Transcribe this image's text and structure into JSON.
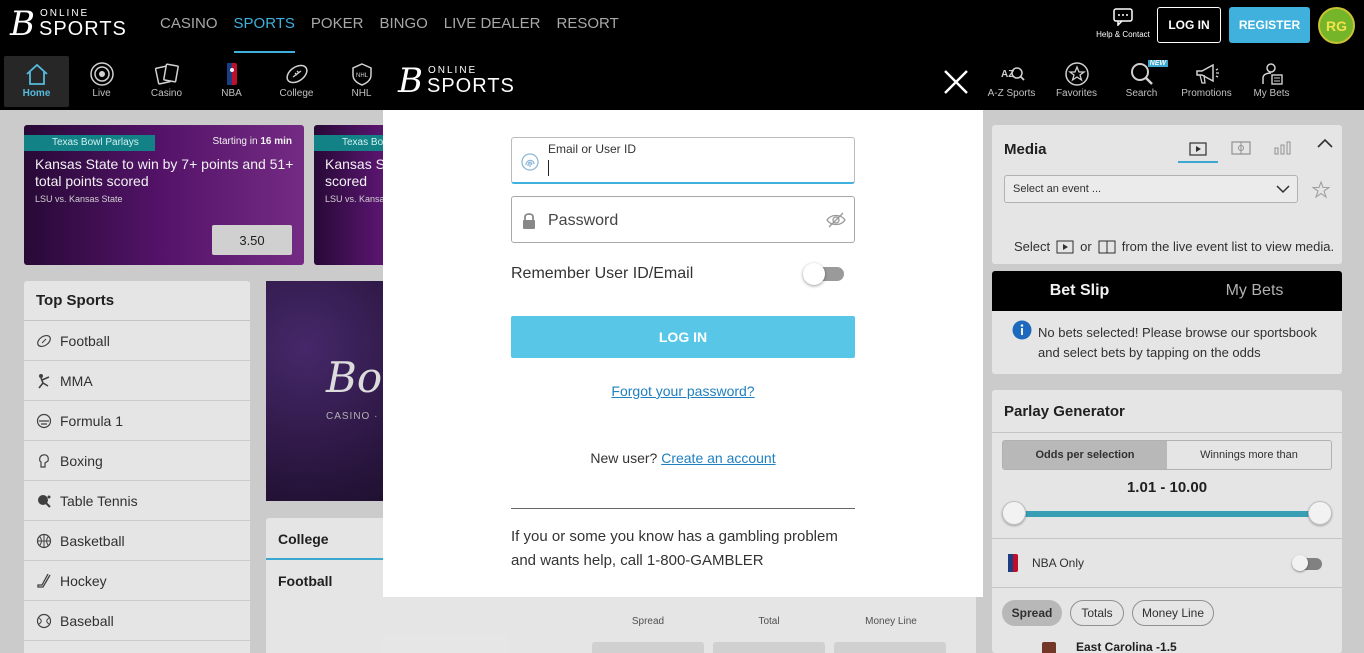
{
  "brand": {
    "mark": "B",
    "online": "ONLINE",
    "sports": "SPORTS"
  },
  "topnav": [
    "CASINO",
    "SPORTS",
    "POKER",
    "BINGO",
    "LIVE DEALER",
    "RESORT"
  ],
  "header": {
    "help": "Help & Contact",
    "login": "LOG IN",
    "register": "REGISTER",
    "rg": "RG"
  },
  "subnav": {
    "left": [
      {
        "label": "Home",
        "icon": "home-icon"
      },
      {
        "label": "Live",
        "icon": "live-icon"
      },
      {
        "label": "Casino",
        "icon": "casino-cards-icon"
      },
      {
        "label": "NBA",
        "icon": "nba-icon"
      },
      {
        "label": "College",
        "icon": "football-icon"
      },
      {
        "label": "NHL",
        "icon": "nhl-icon"
      }
    ],
    "right": [
      {
        "label": "A-Z Sports",
        "icon": "az-sports-icon"
      },
      {
        "label": "Favorites",
        "icon": "star-icon"
      },
      {
        "label": "Search",
        "icon": "search-icon",
        "badge": "NEW"
      },
      {
        "label": "Promotions",
        "icon": "megaphone-icon"
      },
      {
        "label": "My Bets",
        "icon": "my-bets-icon"
      }
    ]
  },
  "promos": [
    {
      "tag": "Texas Bowl Parlays",
      "start_prefix": "Starting in ",
      "start_time": "16 min",
      "title": "Kansas State to win by 7+ points and 51+ total points scored",
      "teams": "LSU vs. Kansas State",
      "odds": "3.50"
    },
    {
      "tag": "Texas Bowl",
      "title": "Kansas Sta scored",
      "teams": "LSU vs. Kansa"
    }
  ],
  "top_sports": {
    "title": "Top Sports",
    "items": [
      "Football",
      "MMA",
      "Formula 1",
      "Boxing",
      "Table Tennis",
      "Basketball",
      "Hockey",
      "Baseball"
    ]
  },
  "banner": {
    "text": "Bo",
    "sub": "CASINO · R"
  },
  "college": {
    "tab": "College Football",
    "headers": [
      "Spread",
      "Total",
      "Money Line"
    ]
  },
  "media": {
    "title": "Media",
    "select_placeholder": "Select an event ...",
    "hint_prefix": "Select",
    "hint_or": "or",
    "hint_suffix": "from the live event list to view media."
  },
  "betslip": {
    "tab_active": "Bet Slip",
    "tab_inactive": "My Bets",
    "message": "No bets selected! Please browse our sportsbook and select bets by tapping on the odds"
  },
  "parlay": {
    "title": "Parlay Generator",
    "toggle": [
      "Odds per selection",
      "Winnings more than"
    ],
    "range": "1.01 - 10.00",
    "range_low_fraction": 0,
    "range_high_fraction": 1,
    "nba_only": "NBA Only",
    "pills": [
      "Spread",
      "Totals",
      "Money Line"
    ],
    "row_label": "East Carolina -1.5"
  },
  "modal": {
    "email_label": "Email or User ID",
    "password_label": "Password",
    "remember": "Remember User ID/Email",
    "login": "LOG IN",
    "forgot": "Forgot your password?",
    "new_user": "New user?",
    "create": "Create an account",
    "gambling": "If you or some you know has a gambling problem and wants help, call 1-800-GAMBLER"
  },
  "colors": {
    "accent": "#3fb1dc",
    "login_button": "#58c7e7",
    "header": "#000000",
    "promo_tag": "#148a8f"
  }
}
